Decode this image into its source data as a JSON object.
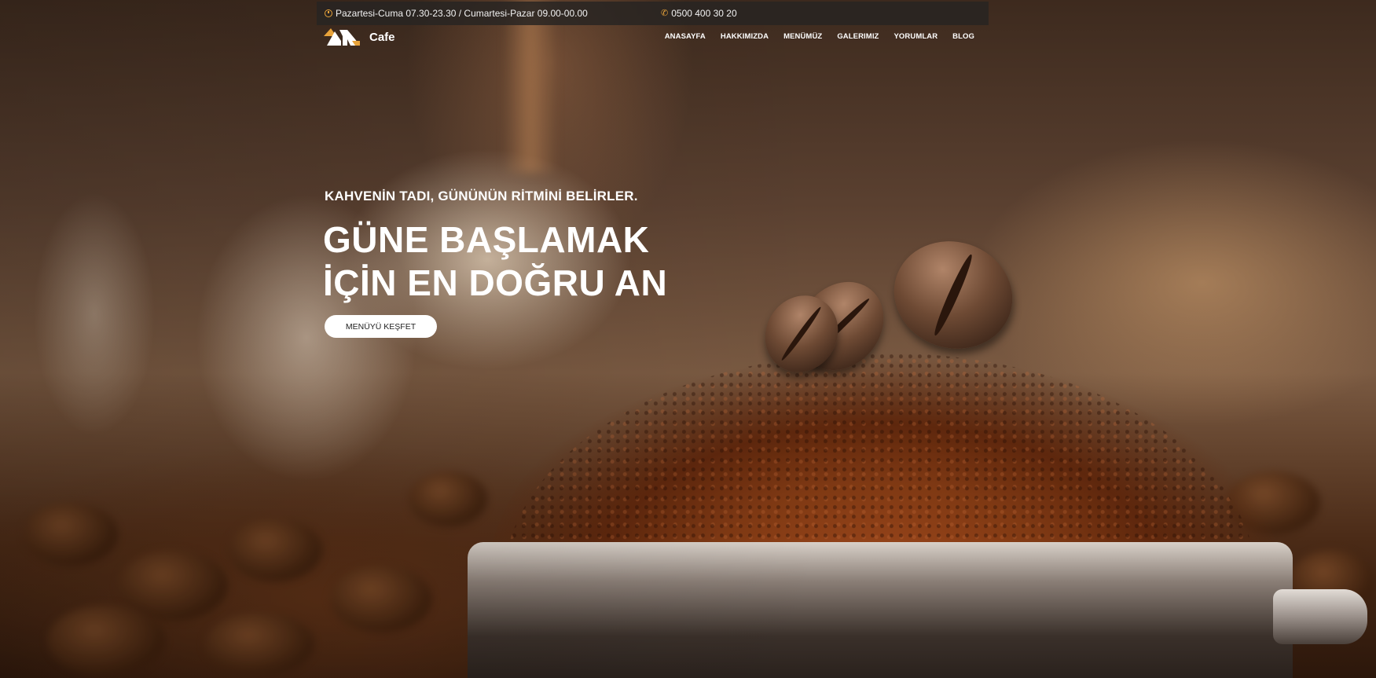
{
  "topbar": {
    "hours": "Pazartesi-Cuma 07.30-23.30 / Cumartesi-Pazar 09.00-00.00",
    "phone": "0500 400 30 20"
  },
  "brand": {
    "name": "Cafe"
  },
  "nav": {
    "items": [
      "ANASAYFA",
      "HAKKIMIZDA",
      "MENÜMÜZ",
      "GALERIMIZ",
      "YORUMLAR",
      "BLOG"
    ]
  },
  "hero": {
    "kicker": "KAHVENİN TADI, GÜNÜNÜN RİTMİNİ BELİRLER.",
    "headline_line1": "GÜNE BAŞLAMAK",
    "headline_line2": "İÇİN EN DOĞRU AN",
    "cta_label": "MENÜYÜ KEŞFET"
  },
  "colors": {
    "accent": "#e8a33a",
    "topbar_bg": "#282422",
    "cta_bg": "#ffffff"
  }
}
